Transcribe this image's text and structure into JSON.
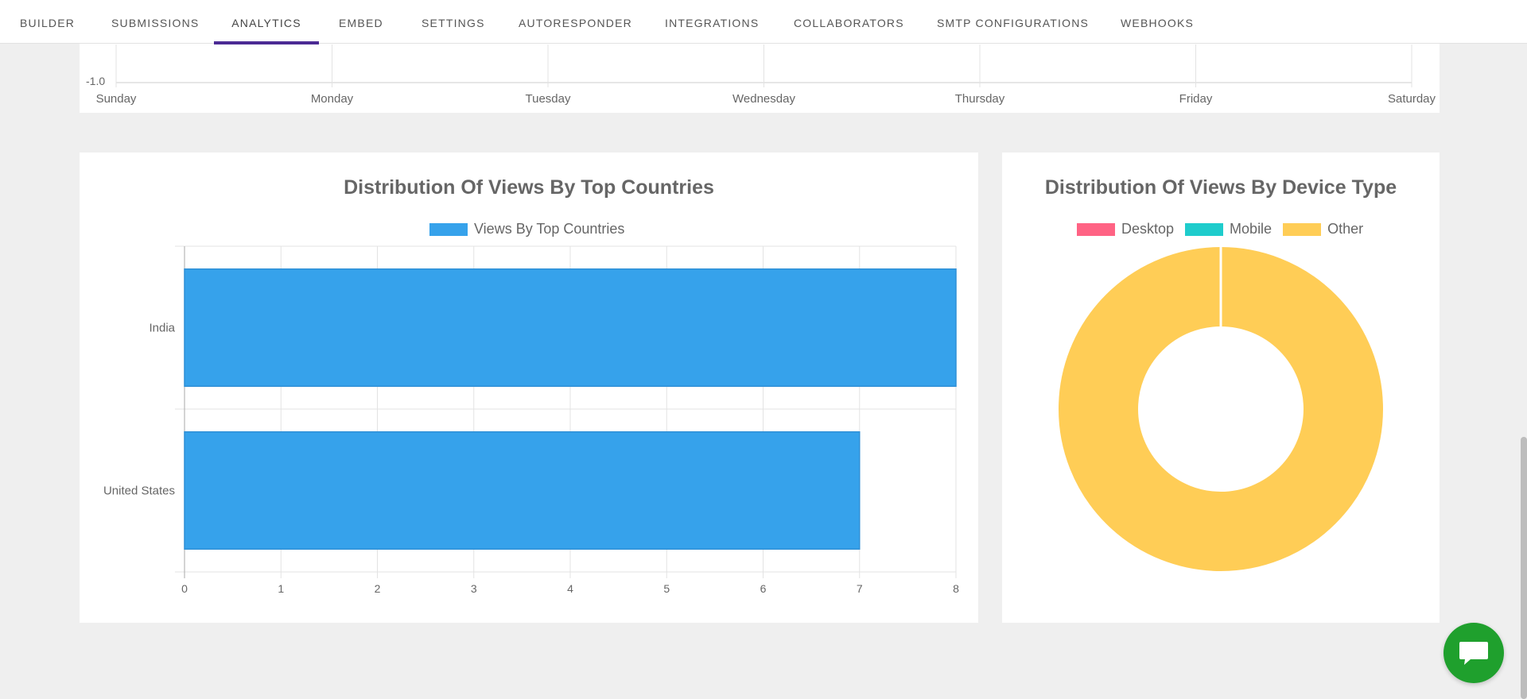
{
  "nav": {
    "tabs": [
      {
        "label": "BUILDER"
      },
      {
        "label": "SUBMISSIONS"
      },
      {
        "label": "ANALYTICS",
        "active": true
      },
      {
        "label": "EMBED"
      },
      {
        "label": "SETTINGS"
      },
      {
        "label": "AUTORESPONDER"
      },
      {
        "label": "INTEGRATIONS"
      },
      {
        "label": "COLLABORATORS"
      },
      {
        "label": "SMTP CONFIGURATIONS"
      },
      {
        "label": "WEBHOOKS"
      }
    ],
    "accent": "#4b2a94"
  },
  "weekday_chart": {
    "y_tick_visible": "-1.0",
    "x_labels": [
      "Sunday",
      "Monday",
      "Tuesday",
      "Wednesday",
      "Thursday",
      "Friday",
      "Saturday"
    ]
  },
  "countries_chart": {
    "title": "Distribution Of Views By Top Countries",
    "legend": "Views By Top Countries",
    "bar_color": "#36a2eb"
  },
  "device_chart": {
    "title": "Distribution Of Views By Device Type",
    "legend": [
      {
        "label": "Desktop",
        "color": "#ff6384"
      },
      {
        "label": "Mobile",
        "color": "#1fcccc"
      },
      {
        "label": "Other",
        "color": "#ffcd56"
      }
    ]
  },
  "chat": {
    "icon": "chat-bubble-icon",
    "color": "#1fa02d"
  },
  "chart_data": [
    {
      "type": "line",
      "x": [
        "Sunday",
        "Monday",
        "Tuesday",
        "Wednesday",
        "Thursday",
        "Friday",
        "Saturday"
      ],
      "visible_y_ticks": [
        "-1.0"
      ]
    },
    {
      "type": "bar",
      "orientation": "horizontal",
      "title": "Distribution Of Views By Top Countries",
      "categories": [
        "India",
        "United States"
      ],
      "series": [
        {
          "name": "Views By Top Countries",
          "values": [
            8,
            7
          ]
        }
      ],
      "xlim": [
        0,
        8
      ],
      "x_ticks": [
        0,
        1,
        2,
        3,
        4,
        5,
        6,
        7,
        8
      ],
      "grid": true,
      "legend": "top"
    },
    {
      "type": "pie",
      "variant": "doughnut",
      "title": "Distribution Of Views By Device Type",
      "labels": [
        "Desktop",
        "Mobile",
        "Other"
      ],
      "values": [
        0,
        0,
        1
      ],
      "legend": "top"
    }
  ]
}
